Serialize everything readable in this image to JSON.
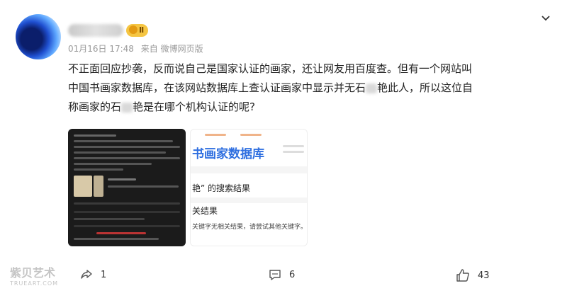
{
  "post": {
    "badge_label": "Ⅱ",
    "date": "01月16日 17:48",
    "source": "来自 微博网页版",
    "text_line1": "不正面回应抄袭，反而说自己是国家认证的画家，还让网友用百度查。但有一个网站叫",
    "text_line2a": "中国书画家数据库，在该网站数据库上查认证画家中显示并无石",
    "text_line2b": "艳此人，所以这位自",
    "text_line3a": "称画家的石",
    "text_line3b": "艳是在哪个机构认证的呢?"
  },
  "thumb2": {
    "title": "书画家数据库",
    "search_result": "艳” 的搜索结果",
    "related": "关结果",
    "hint": "关键字无相关结果，请尝试其他关键字。"
  },
  "actions": {
    "share_count": "1",
    "comment_count": "6",
    "like_count": "43"
  },
  "watermark": {
    "main": "紫贝艺术",
    "sub": "TRUEART.COM"
  },
  "icons": {
    "more": "chevron-down-icon",
    "share": "share-icon",
    "comment": "comment-icon",
    "like": "thumbs-up-icon"
  }
}
